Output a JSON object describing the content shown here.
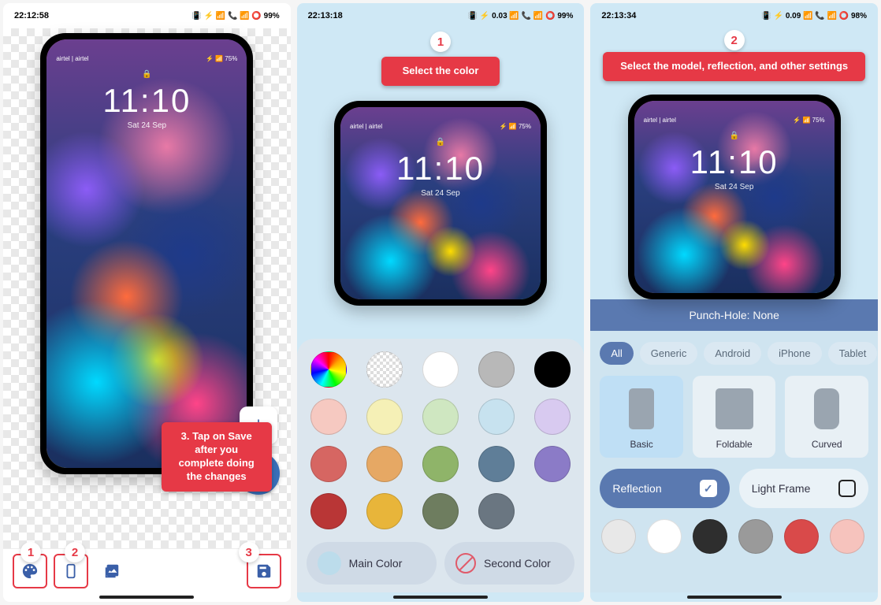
{
  "screen1": {
    "status": {
      "time": "22:12:58",
      "right": "📳 ⚡ 📶 📞 📶 ⭕ 99%"
    },
    "lock": {
      "carrier": "airtel | airtel",
      "right": "⚡ 📶 75%",
      "time": "11:10",
      "date": "Sat 24 Sep"
    },
    "badges": {
      "b1": "1",
      "b2": "2",
      "b3": "3"
    },
    "callout": "3. Tap on Save after you complete doing the changes"
  },
  "screen2": {
    "status": {
      "time": "22:13:18",
      "right": "📳 ⚡ 0.03 📶 📞 📶 ⭕ 99%"
    },
    "badge": "1",
    "callout": "Select the color",
    "lock": {
      "carrier": "airtel | airtel",
      "right": "⚡ 📶 75%",
      "time": "11:10",
      "date": "Sat 24 Sep"
    },
    "colors_row2": [
      "#f6c9c1",
      "#f5f0b6",
      "#cfe7c1",
      "#c7e2ef",
      "#d8caf0"
    ],
    "colors_row3": [
      "#d66662",
      "#e6a864",
      "#8fb469",
      "#5f7e98",
      "#8b7bc7"
    ],
    "colors_row4": [
      "#b93636",
      "#e8b53a",
      "#6e7d5f",
      "#6a7681",
      ""
    ],
    "btn_main": "Main Color",
    "btn_second": "Second Color",
    "main_color_dot": "#bcdceb"
  },
  "screen3": {
    "status": {
      "time": "22:13:34",
      "right": "📳 ⚡ 0.09 📶 📞 📶 ⭕ 98%"
    },
    "badge": "2",
    "callout": "Select the model, reflection, and other settings",
    "lock": {
      "carrier": "airtel | airtel",
      "right": "⚡ 📶 75%",
      "time": "11:10",
      "date": "Sat 24 Sep"
    },
    "punch": "Punch-Hole: None",
    "chips": {
      "all": "All",
      "generic": "Generic",
      "android": "Android",
      "iphone": "iPhone",
      "tablet": "Tablet"
    },
    "models": {
      "basic": "Basic",
      "foldable": "Foldable",
      "curved": "Curved"
    },
    "toggles": {
      "reflection": "Reflection",
      "light": "Light Frame"
    },
    "variants": [
      "#e8e8e8",
      "#ffffff",
      "#2e2e2e",
      "#9a9a9a",
      "#d94a4a",
      "#f6c3bd"
    ]
  }
}
